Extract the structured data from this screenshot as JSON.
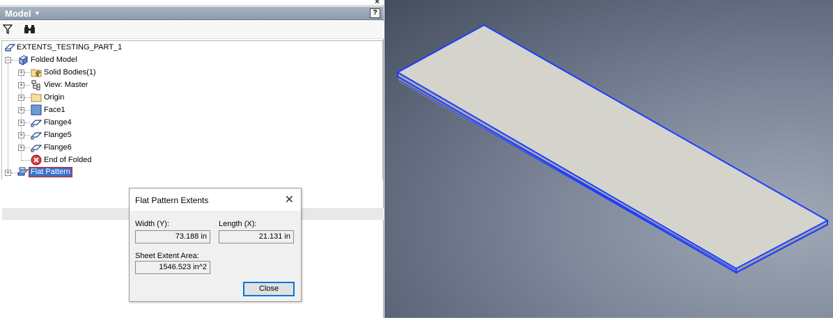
{
  "browser": {
    "title": "Model",
    "help_label": "?",
    "tree": [
      {
        "label": "EXTENTS_TESTING_PART_1",
        "icon": "sheet-metal-part-icon"
      },
      {
        "label": "Folded Model",
        "icon": "folded-model-icon"
      },
      {
        "label": "Solid Bodies(1)",
        "icon": "solid-bodies-folder-icon"
      },
      {
        "label": "View: Master",
        "icon": "view-icon"
      },
      {
        "label": "Origin",
        "icon": "folder-icon"
      },
      {
        "label": "Face1",
        "icon": "face-icon"
      },
      {
        "label": "Flange4",
        "icon": "flange-icon"
      },
      {
        "label": "Flange5",
        "icon": "flange-icon"
      },
      {
        "label": "Flange6",
        "icon": "flange-icon"
      },
      {
        "label": "End of Folded",
        "icon": "end-of-part-icon"
      },
      {
        "label": "Flat Pattern",
        "icon": "flat-pattern-icon"
      }
    ]
  },
  "dialog": {
    "title": "Flat Pattern Extents",
    "width_label": "Width (Y):",
    "width_value": "73.188 in",
    "length_label": "Length (X):",
    "length_value": "21.131 in",
    "area_label": "Sheet Extent Area:",
    "area_value": "1546.523 in^2",
    "close_label": "Close"
  },
  "colors": {
    "selection_edge": "#1a3cff",
    "plate_face": "#d4d3cc",
    "browser_header": "#95a2b2"
  }
}
